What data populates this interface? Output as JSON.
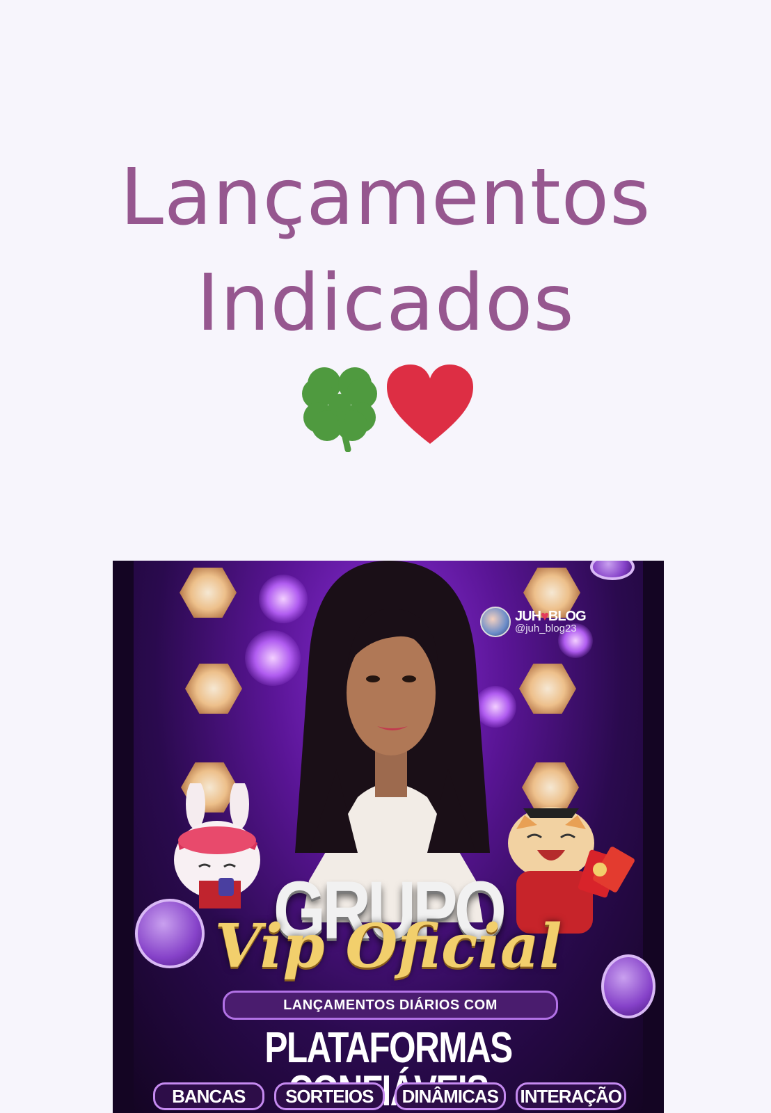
{
  "header": {
    "title_line1": "Lançamentos",
    "title_line2": "Indicados",
    "emojis": [
      "four-leaf-clover-icon",
      "red-heart-icon"
    ]
  },
  "banner": {
    "handle_name_part1": "JUH",
    "handle_name_part2": "BLOG",
    "handle_user": "@juh_blog23",
    "headline": "GRUPO",
    "script_text": "Vip Oficial",
    "pill_text": "LANÇAMENTOS DIÁRIOS COM",
    "subheadline": "PLATAFORMAS CONFIÁVEIS",
    "tags": [
      "BANCAS",
      "SORTEIOS",
      "DINÂMICAS",
      "INTERAÇÃO"
    ],
    "colors": {
      "accent": "#96578f",
      "gold": "#f2cf6c",
      "purple": "#5a1596"
    }
  }
}
